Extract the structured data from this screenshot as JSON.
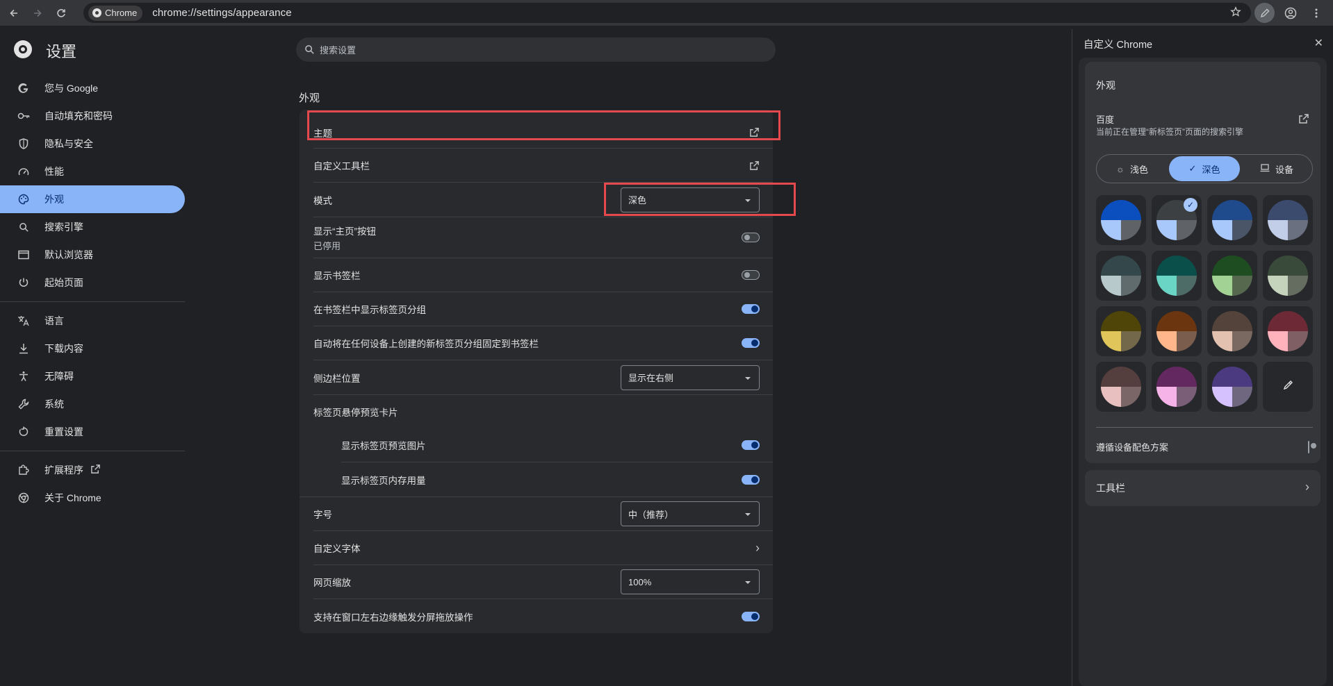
{
  "browser": {
    "chip_label": "Chrome",
    "url": "chrome://settings/appearance"
  },
  "icons": {
    "back": "arrow-left-icon",
    "forward": "arrow-right-icon",
    "reload": "reload-icon",
    "bookmark": "star-icon",
    "customize": "pencil-icon",
    "profile": "profile-icon",
    "menu": "kebab-menu-icon"
  },
  "settings": {
    "title": "设置",
    "search_placeholder": "搜索设置"
  },
  "nav": {
    "items": [
      {
        "label": "您与 Google",
        "icon": "google-icon"
      },
      {
        "label": "自动填充和密码",
        "icon": "key-icon"
      },
      {
        "label": "隐私与安全",
        "icon": "shield-icon"
      },
      {
        "label": "性能",
        "icon": "gauge-icon"
      },
      {
        "label": "外观",
        "icon": "palette-icon",
        "active": true
      },
      {
        "label": "搜索引擎",
        "icon": "search-icon"
      },
      {
        "label": "默认浏览器",
        "icon": "browser-window-icon"
      },
      {
        "label": "起始页面",
        "icon": "power-icon"
      },
      {
        "label": "语言",
        "icon": "translate-icon"
      },
      {
        "label": "下载内容",
        "icon": "download-icon"
      },
      {
        "label": "无障碍",
        "icon": "accessibility-icon"
      },
      {
        "label": "系统",
        "icon": "wrench-icon"
      },
      {
        "label": "重置设置",
        "icon": "reset-icon"
      },
      {
        "label": "扩展程序",
        "icon": "puzzle-icon"
      },
      {
        "label": "关于 Chrome",
        "icon": "chrome-icon"
      }
    ]
  },
  "appearance": {
    "section_title": "外观",
    "rows": {
      "theme": "主题",
      "custom_toolbar": "自定义工具栏",
      "mode": "模式",
      "mode_value": "深色",
      "home_button": "显示“主页”按钮",
      "home_button_sub": "已停用",
      "bookmarks_bar": "显示书签栏",
      "tab_groups_bar": "在书签栏中显示标签页分组",
      "autopin_groups": "自动将在任何设备上创建的新标签页分组固定到书签栏",
      "sidebar_position": "侧边栏位置",
      "sidebar_position_value": "显示在右侧",
      "hover_card": "标签页悬停预览卡片",
      "hover_preview_image": "显示标签页预览图片",
      "hover_memory": "显示标签页内存用量",
      "font_size": "字号",
      "font_size_value": "中（推荐）",
      "custom_fonts": "自定义字体",
      "page_zoom": "网页缩放",
      "page_zoom_value": "100%",
      "split_drag": "支持在窗口左右边缘触发分屏拖放操作"
    },
    "toggles": {
      "home_button": false,
      "bookmarks_bar": false,
      "tab_groups_bar": true,
      "autopin_groups": true,
      "hover_preview_image": true,
      "hover_memory": true,
      "split_drag": true
    }
  },
  "side_panel": {
    "title": "自定义 Chrome",
    "card_title": "外观",
    "engine_name": "百度",
    "engine_sub": "当前正在管理“新标签页”页面的搜索引擎",
    "mode_light": "浅色",
    "mode_dark": "深色",
    "mode_device": "设备",
    "follow_device": "遵循设备配色方案",
    "toolbar": "工具栏",
    "swatches": [
      {
        "top": "#0b4fbf",
        "bl": "#a8c7fa",
        "br": "#5f6368"
      },
      {
        "top": "#3c4043",
        "bl": "#a8c7fa",
        "br": "#5f6368",
        "selected": true
      },
      {
        "top": "#1f4a8c",
        "bl": "#a8c7fa",
        "br": "#4a5568"
      },
      {
        "top": "#3b4b6e",
        "bl": "#c2cde8",
        "br": "#6a7080"
      },
      {
        "top": "#34474b",
        "bl": "#b8c9cc",
        "br": "#5f6b6d"
      },
      {
        "top": "#0b4f4a",
        "bl": "#6ad5c4",
        "br": "#4d6b67"
      },
      {
        "top": "#1f4d22",
        "bl": "#a3d295",
        "br": "#56694f"
      },
      {
        "top": "#3a4a3a",
        "bl": "#c5d3bd",
        "br": "#656d61"
      },
      {
        "top": "#4f4508",
        "bl": "#e0c65a",
        "br": "#73694a"
      },
      {
        "top": "#6b3510",
        "bl": "#ffb68a",
        "br": "#7a5d4d"
      },
      {
        "top": "#54433b",
        "bl": "#e3c1b0",
        "br": "#7a6961"
      },
      {
        "top": "#6d2a36",
        "bl": "#ffb2bc",
        "br": "#7f5f64"
      },
      {
        "top": "#553e3e",
        "bl": "#e8c0c0",
        "br": "#7a6666"
      },
      {
        "top": "#63285f",
        "bl": "#f5b3e8",
        "br": "#7a5d77"
      },
      {
        "top": "#4b3a80",
        "bl": "#d6c1ff",
        "br": "#6f6680"
      }
    ],
    "custom_swatch_icon": "eyedropper-icon"
  },
  "colors": {
    "accent": "#8ab4f8",
    "highlight_box": "#e5484d"
  }
}
